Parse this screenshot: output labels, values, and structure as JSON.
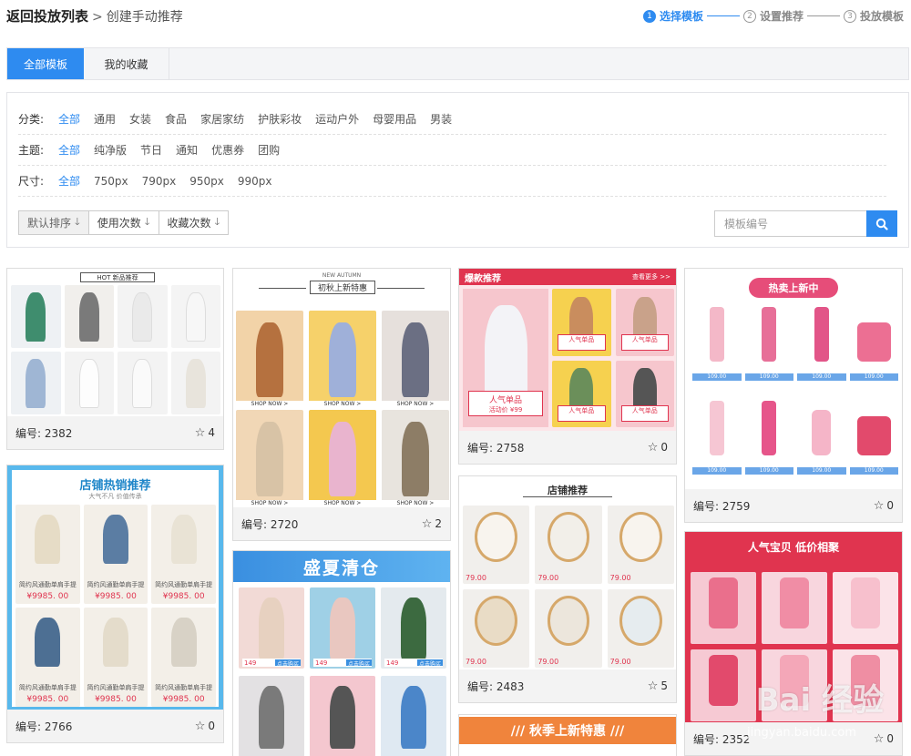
{
  "header": {
    "back_label": "返回投放列表",
    "separator": ">",
    "current": "创建手动推荐",
    "steps": [
      {
        "num": "1",
        "label": "选择模板"
      },
      {
        "num": "2",
        "label": "设置推荐"
      },
      {
        "num": "3",
        "label": "投放模板"
      }
    ]
  },
  "tabs": [
    "全部模板",
    "我的收藏"
  ],
  "filters": {
    "category": {
      "label": "分类:",
      "options": [
        "全部",
        "通用",
        "女装",
        "食品",
        "家居家纺",
        "护肤彩妆",
        "运动户外",
        "母婴用品",
        "男装"
      ]
    },
    "theme": {
      "label": "主题:",
      "options": [
        "全部",
        "纯净版",
        "节日",
        "通知",
        "优惠券",
        "团购"
      ]
    },
    "size": {
      "label": "尺寸:",
      "options": [
        "全部",
        "750px",
        "790px",
        "950px",
        "990px"
      ]
    }
  },
  "sort": [
    "默认排序",
    "使用次数",
    "收藏次数"
  ],
  "search": {
    "placeholder": "模板编号"
  },
  "cards": [
    {
      "id": "编号: 2382",
      "favs": "4",
      "banner": "HOT 新品推荐"
    },
    {
      "id": "编号: 2766",
      "favs": "0",
      "banner": "店铺热销推荐",
      "sub": "大气不凡 价值传承",
      "caption": "简约风通勤单肩手提",
      "price": "¥9985. 00"
    },
    {
      "id": "编号: 2720",
      "favs": "2",
      "banner": "初秋上新特惠",
      "sub": "NEW AUTUMN",
      "cta": "SHOP NOW >"
    },
    {
      "id": "",
      "favs": "",
      "banner": "盛夏清仓",
      "price": "149",
      "cta": "点击购买"
    },
    {
      "id": "编号: 2758",
      "favs": "0",
      "banner": "爆款推荐",
      "more": "查看更多 >>",
      "hot": "人气单品",
      "hot_price": "99",
      "hot_sub": "活动价"
    },
    {
      "id": "编号: 2483",
      "favs": "5",
      "banner": "店铺推荐",
      "price": "79.00"
    },
    {
      "id": "",
      "favs": "",
      "banner": "/// 秋季上新特惠 ///"
    },
    {
      "id": "编号: 2759",
      "favs": "0",
      "banner": "热卖上新中",
      "price": "109.00"
    },
    {
      "id": "编号: 2352",
      "favs": "0",
      "banner": "人气宝贝 低价相聚"
    }
  ],
  "watermark": {
    "main": "Bai 经验",
    "sub": "jingyan.baidu.com"
  },
  "colors": {
    "accent": "#2e8bf0",
    "red": "#e0344f",
    "pink": "#f7c9cf"
  }
}
